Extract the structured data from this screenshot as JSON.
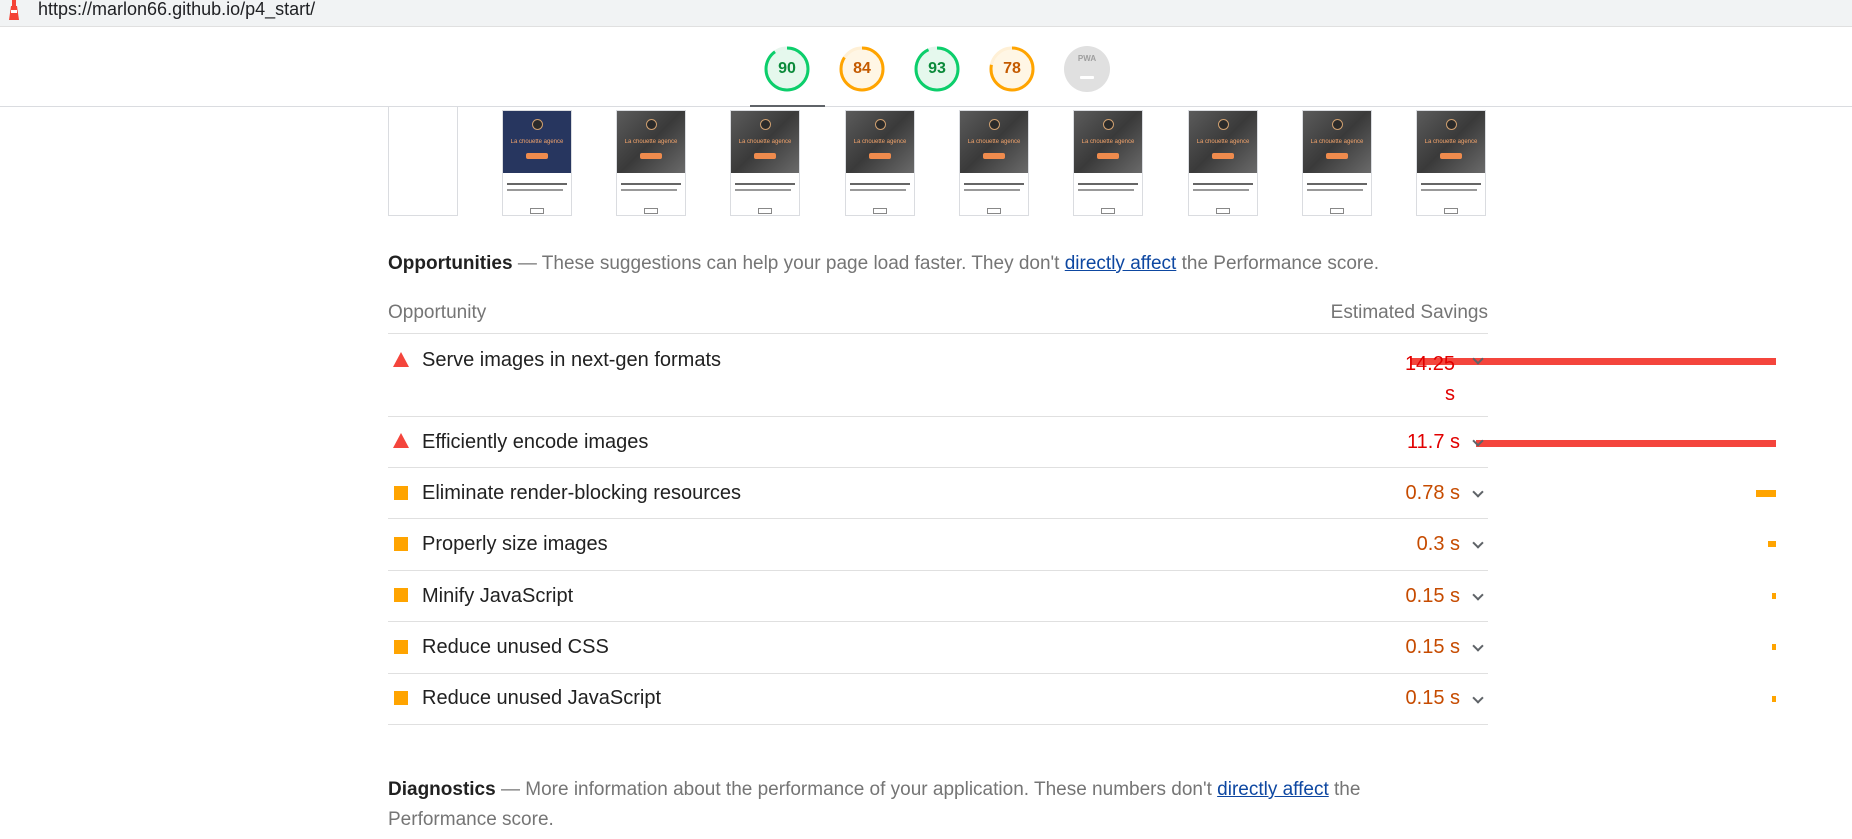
{
  "browser": {
    "url": "https://marlon66.github.io/p4_start/"
  },
  "scores": [
    {
      "label": "90",
      "value": 90,
      "rating": "pass",
      "color": "#0cce6b"
    },
    {
      "label": "84",
      "value": 84,
      "rating": "average",
      "color": "#ffa400"
    },
    {
      "label": "93",
      "value": 93,
      "rating": "pass",
      "color": "#0cce6b"
    },
    {
      "label": "78",
      "value": 78,
      "rating": "average",
      "color": "#ffa400"
    },
    {
      "label": "PWA",
      "value": null,
      "rating": "na",
      "color": "#e0e0e0"
    }
  ],
  "filmstrip": {
    "frame_caption": "La chouette agence",
    "frame_count": 10
  },
  "opportunities": {
    "heading": "Opportunities",
    "description_before": " — These suggestions can help your page load faster. They don't ",
    "link": "directly affect",
    "description_after": " the Performance score.",
    "column_left": "Opportunity",
    "column_right": "Estimated Savings",
    "items": [
      {
        "title": "Serve images in next-gen formats",
        "savings": "14.25 s",
        "savings_seconds": 14.25,
        "rating": "fail",
        "icon": "fail-triangle-icon"
      },
      {
        "title": "Efficiently encode images",
        "savings": "11.7 s",
        "savings_seconds": 11.7,
        "rating": "fail",
        "icon": "fail-triangle-icon"
      },
      {
        "title": "Eliminate render-blocking resources",
        "savings": "0.78 s",
        "savings_seconds": 0.78,
        "rating": "average",
        "icon": "average-square-icon"
      },
      {
        "title": "Properly size images",
        "savings": "0.3 s",
        "savings_seconds": 0.3,
        "rating": "average",
        "icon": "average-square-icon"
      },
      {
        "title": "Minify JavaScript",
        "savings": "0.15 s",
        "savings_seconds": 0.15,
        "rating": "average",
        "icon": "average-square-icon"
      },
      {
        "title": "Reduce unused CSS",
        "savings": "0.15 s",
        "savings_seconds": 0.15,
        "rating": "average",
        "icon": "average-square-icon"
      },
      {
        "title": "Reduce unused JavaScript",
        "savings": "0.15 s",
        "savings_seconds": 0.15,
        "rating": "average",
        "icon": "average-square-icon"
      }
    ]
  },
  "diagnostics": {
    "heading": "Diagnostics",
    "description_before": " — More information about the performance of your application. These numbers don't ",
    "link": "directly affect",
    "description_after": " the",
    "description_line2": "Performance score."
  },
  "colors": {
    "fail": "#f4453c",
    "average": "#ffa400",
    "pass": "#0cce6b",
    "link": "#0d47a1"
  }
}
